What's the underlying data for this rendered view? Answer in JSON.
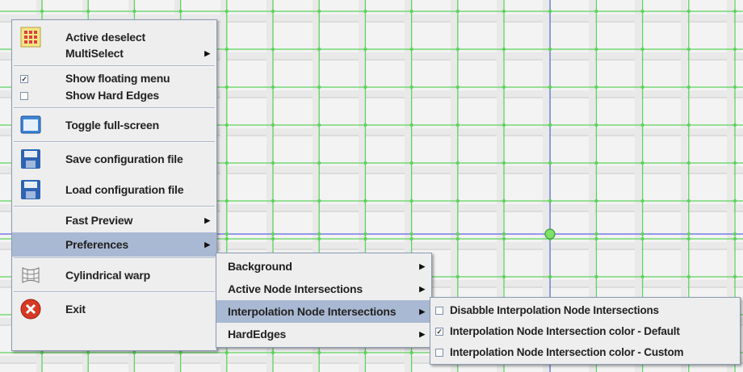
{
  "main_menu": {
    "items": [
      {
        "label": "Active deselect",
        "icon": "grid-select-icon"
      },
      {
        "label": "MultiSelect",
        "submenu": true
      },
      {
        "label": "Show floating menu",
        "checked": true
      },
      {
        "label": "Show Hard Edges",
        "checked": false
      },
      {
        "label": "Toggle full-screen",
        "icon": "window-icon"
      },
      {
        "label": "Save configuration file",
        "icon": "floppy-disk-icon"
      },
      {
        "label": "Load configuration file",
        "icon": "floppy-disk-icon"
      },
      {
        "label": "Fast Preview",
        "submenu": true
      },
      {
        "label": "Preferences",
        "submenu": true,
        "selected": true
      },
      {
        "label": "Cylindrical warp",
        "icon": "cylinder-warp-icon"
      },
      {
        "label": "Exit",
        "icon": "exit-icon"
      }
    ]
  },
  "preferences_menu": {
    "items": [
      {
        "label": "Background",
        "submenu": true
      },
      {
        "label": "Active Node Intersections",
        "submenu": true
      },
      {
        "label": "Interpolation Node Intersections",
        "submenu": true,
        "selected": true
      },
      {
        "label": "HardEdges",
        "submenu": true
      }
    ]
  },
  "interpolation_menu": {
    "items": [
      {
        "label": "Disabble Interpolation Node Intersections",
        "checked": false
      },
      {
        "label": "Interpolation Node Intersection color - Default",
        "checked": true
      },
      {
        "label": "Interpolation Node Intersection color - Custom",
        "checked": false
      }
    ]
  },
  "colors": {
    "grid_line": "#5ed35e",
    "axis_line": "#7b7be8",
    "menu_bg": "#eeeeee",
    "selection": "#aab9d3"
  }
}
